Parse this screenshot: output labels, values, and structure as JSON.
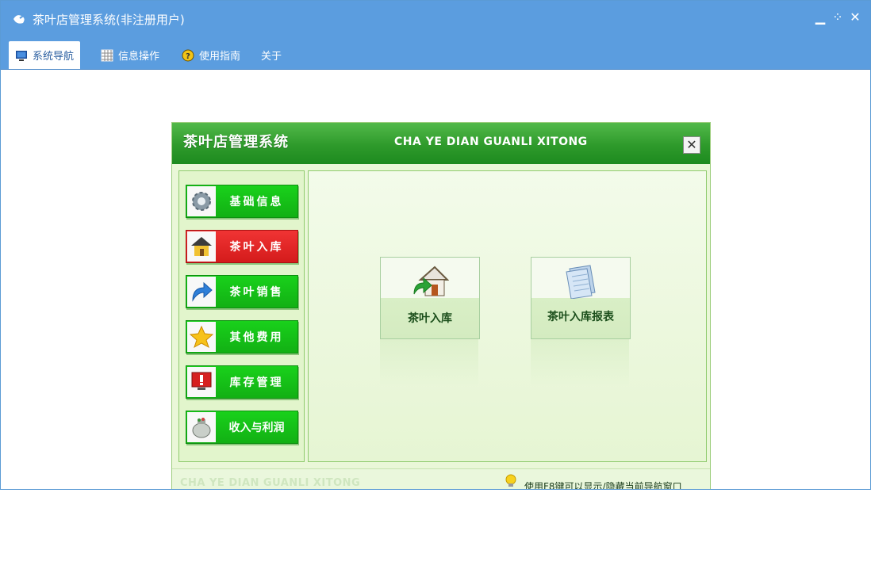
{
  "window": {
    "title": "茶叶店管理系统(非注册用户)",
    "controls": {
      "minimize": "▁",
      "restore": "⁘",
      "close": "✕"
    }
  },
  "menu": {
    "items": [
      {
        "label": "系统导航",
        "icon": "monitor-icon",
        "active": true
      },
      {
        "label": "信息操作",
        "icon": "grid-icon",
        "active": false
      },
      {
        "label": "使用指南",
        "icon": "help-icon",
        "active": false
      },
      {
        "label": "关于",
        "icon": "",
        "active": false
      }
    ]
  },
  "panel": {
    "title": "茶叶店管理系统",
    "subtitle": "CHA YE DIAN GUANLI XITONG",
    "close_label": "✕",
    "sidebar": [
      {
        "label": "基础信息",
        "icon": "gear-icon"
      },
      {
        "label": "茶叶入库",
        "icon": "house-icon",
        "active": true
      },
      {
        "label": "茶叶销售",
        "icon": "arrow-icon"
      },
      {
        "label": "其他费用",
        "icon": "star-icon"
      },
      {
        "label": "库存管理",
        "icon": "alert-monitor-icon"
      },
      {
        "label": "收入与利润",
        "icon": "money-bag-icon"
      }
    ],
    "tiles": [
      {
        "label": "茶叶入库",
        "icon": "house-arrow-icon"
      },
      {
        "label": "茶叶入库报表",
        "icon": "document-icon"
      }
    ],
    "footer": {
      "brand": "CHA YE DIAN GUANLI XITONG",
      "tip": "使用F8键可以显示/隐藏当前导航窗口"
    }
  },
  "colors": {
    "titlebar": "#5b9ddf",
    "header_green": "#2e9a2b",
    "button_green": "#12b014",
    "button_active_red": "#d41b1b"
  }
}
